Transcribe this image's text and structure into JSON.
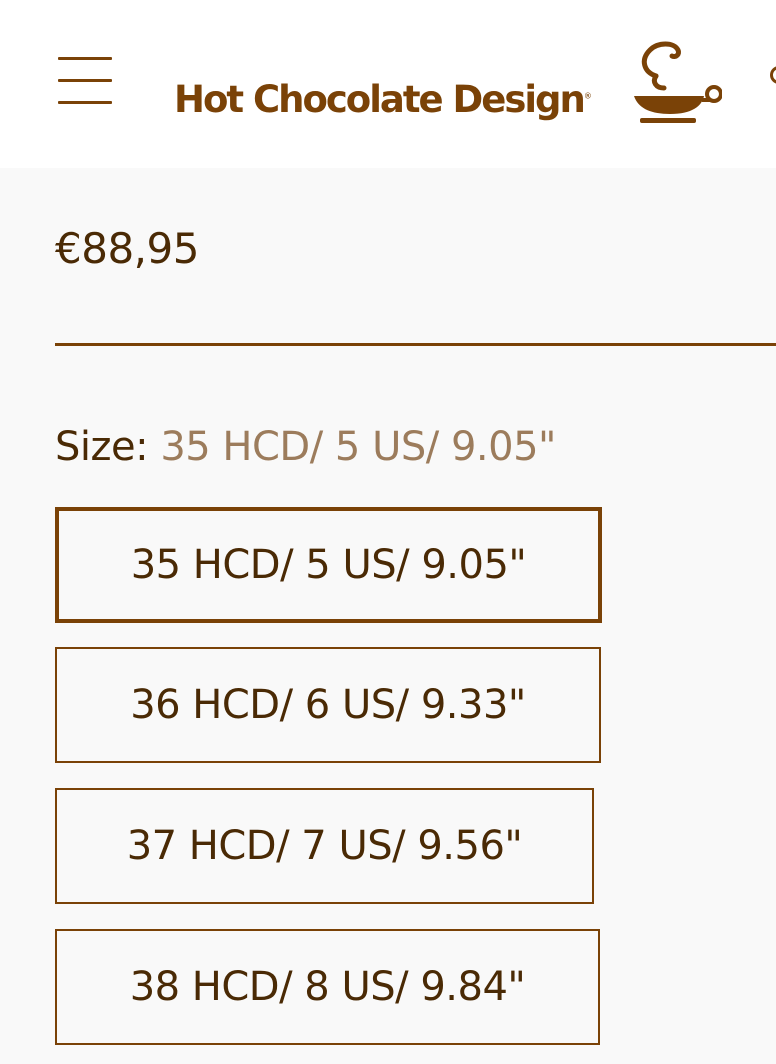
{
  "header": {
    "brand_name": "Hot Chocolate Design",
    "brand_mark": "®",
    "menu_icon": "hamburger-menu-icon",
    "logo_icon": "cup-with-steam-icon",
    "brand_color": "#7a4207"
  },
  "product": {
    "price": "€88,95"
  },
  "size": {
    "label": "Size:",
    "selected_value": "35 HCD/ 5 US/ 9.05\"",
    "options": [
      {
        "label": "35 HCD/ 5 US/ 9.05\"",
        "selected": true
      },
      {
        "label": "36 HCD/ 6 US/ 9.33\"",
        "selected": false
      },
      {
        "label": "37 HCD/ 7 US/ 9.56\"",
        "selected": false
      },
      {
        "label": "38 HCD/ 8 US/ 9.84\"",
        "selected": false
      }
    ]
  },
  "colors": {
    "text_dark": "#4a2a05",
    "text_muted": "#9c7c5c",
    "background": "#f9f9f9",
    "header_background": "#ffffff"
  }
}
